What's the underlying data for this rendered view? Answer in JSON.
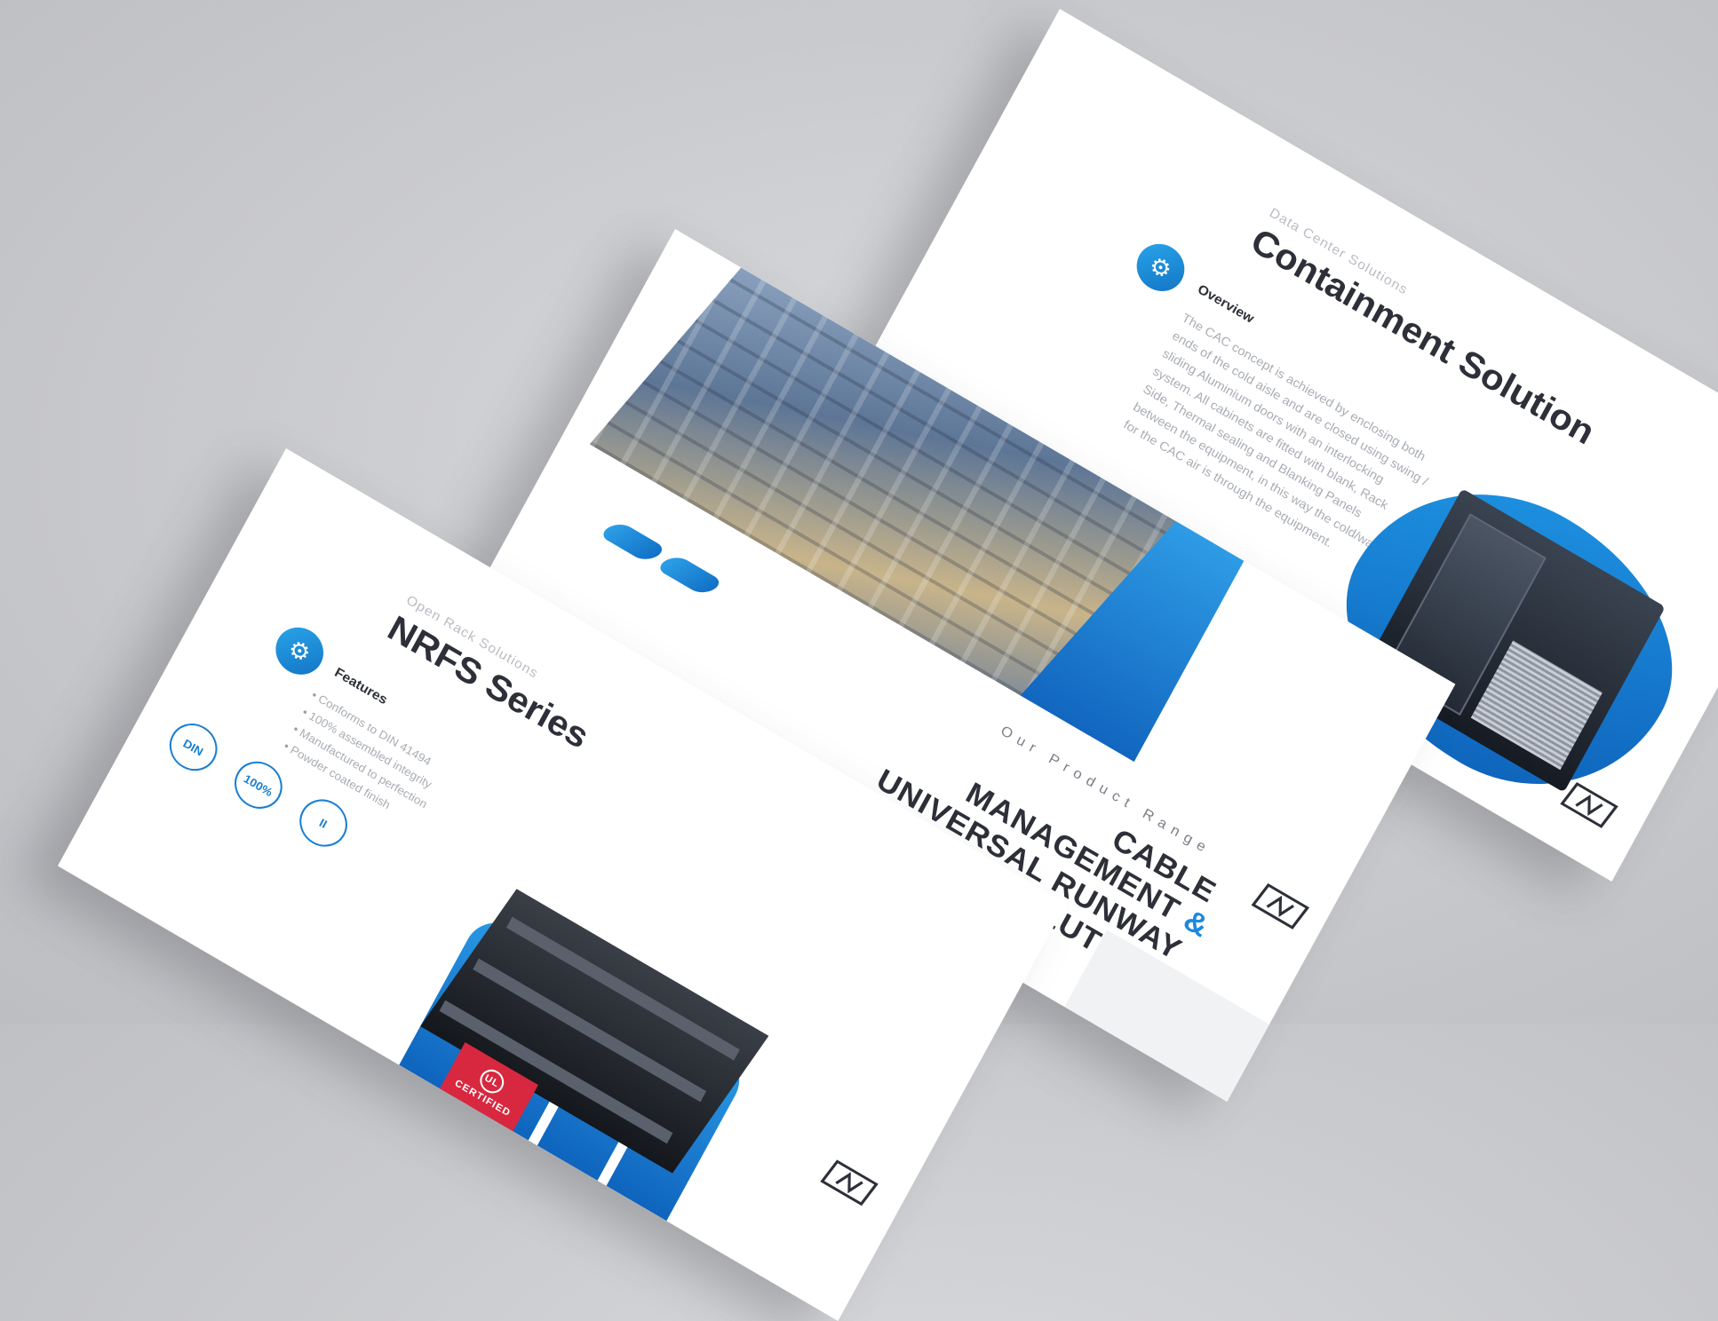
{
  "slides": {
    "containment": {
      "eyebrow": "Data Center Solutions",
      "title": "Containment Solution",
      "section_label": "Overview",
      "body": "The CAC concept is achieved by enclosing both ends of the cold aisle and are closed using swing / sliding Aluminium doors with an interlocking system. All cabinets are fitted with blank, Rack Side, Thermal sealing and Blanking Panels between the equipment, in this way the cold/warm for the CAC air is through the equipment.",
      "accent_color": "#1a86dc"
    },
    "cover": {
      "range_label": "Our Product Range",
      "title_line1": "CABLE",
      "title_line2": "MANAGEMENT &",
      "title_line3": "UNIVERSAL RUNWAY",
      "title_line4": "SOLUTIONS",
      "accent_color": "#1a86dc"
    },
    "nrfs": {
      "eyebrow": "Open Rack Solutions",
      "title": "NRFS Series",
      "section_label": "Features",
      "features": [
        "Conforms to DIN 41494",
        "100% assembled integrity",
        "Manufactured to perfection",
        "Powder coated finish"
      ],
      "cert_1": "DIN",
      "cert_2": "100%",
      "cert_3": "II",
      "ul_mark": "UL",
      "ul_label": "CERTIFIED",
      "ul_color": "#d8283f"
    }
  }
}
